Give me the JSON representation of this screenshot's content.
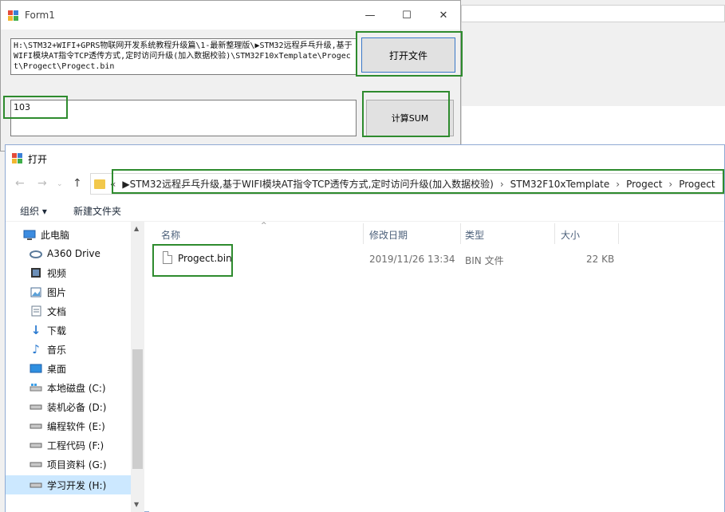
{
  "form1": {
    "title": "Form1",
    "file_path": "H:\\STM32+WIFI+GPRS物联网开发系统教程升级篇\\1-最新整理版\\▶STM32远程乒乓升级,基于WIFI模块AT指令TCP透传方式,定时访问升级(加入数据校验)\\STM32F10xTemplate\\Progect\\Progect\\Progect.bin",
    "open_button": "打开文件",
    "sum_value": "103",
    "calc_button": "计算SUM"
  },
  "dialog": {
    "title": "打开",
    "breadcrumb": [
      "▶STM32远程乒乓升级,基于WIFI模块AT指令TCP透传方式,定时访问升级(加入数据校验)",
      "STM32F10xTemplate",
      "Progect",
      "Progect"
    ],
    "toolbar": {
      "organize": "组织 ▾",
      "new_folder": "新建文件夹"
    },
    "nav_items": [
      {
        "label": "此电脑",
        "icon": "computer-icon"
      },
      {
        "label": "A360 Drive",
        "icon": "cloud-drive-icon"
      },
      {
        "label": "视频",
        "icon": "video-icon"
      },
      {
        "label": "图片",
        "icon": "picture-icon"
      },
      {
        "label": "文档",
        "icon": "document-icon"
      },
      {
        "label": "下载",
        "icon": "download-icon"
      },
      {
        "label": "音乐",
        "icon": "music-icon"
      },
      {
        "label": "桌面",
        "icon": "desktop-icon"
      },
      {
        "label": "本地磁盘 (C:)",
        "icon": "system-drive-icon"
      },
      {
        "label": "装机必备 (D:)",
        "icon": "drive-icon"
      },
      {
        "label": "编程软件 (E:)",
        "icon": "drive-icon"
      },
      {
        "label": "工程代码 (F:)",
        "icon": "drive-icon"
      },
      {
        "label": "项目资料 (G:)",
        "icon": "drive-icon"
      },
      {
        "label": "学习开发 (H:)",
        "icon": "drive-icon"
      }
    ],
    "columns": {
      "name": "名称",
      "modified": "修改日期",
      "type": "类型",
      "size": "大小"
    },
    "files": [
      {
        "name": "Progect.bin",
        "modified": "2019/11/26 13:34",
        "type": "BIN 文件",
        "size": "22 KB"
      }
    ]
  }
}
